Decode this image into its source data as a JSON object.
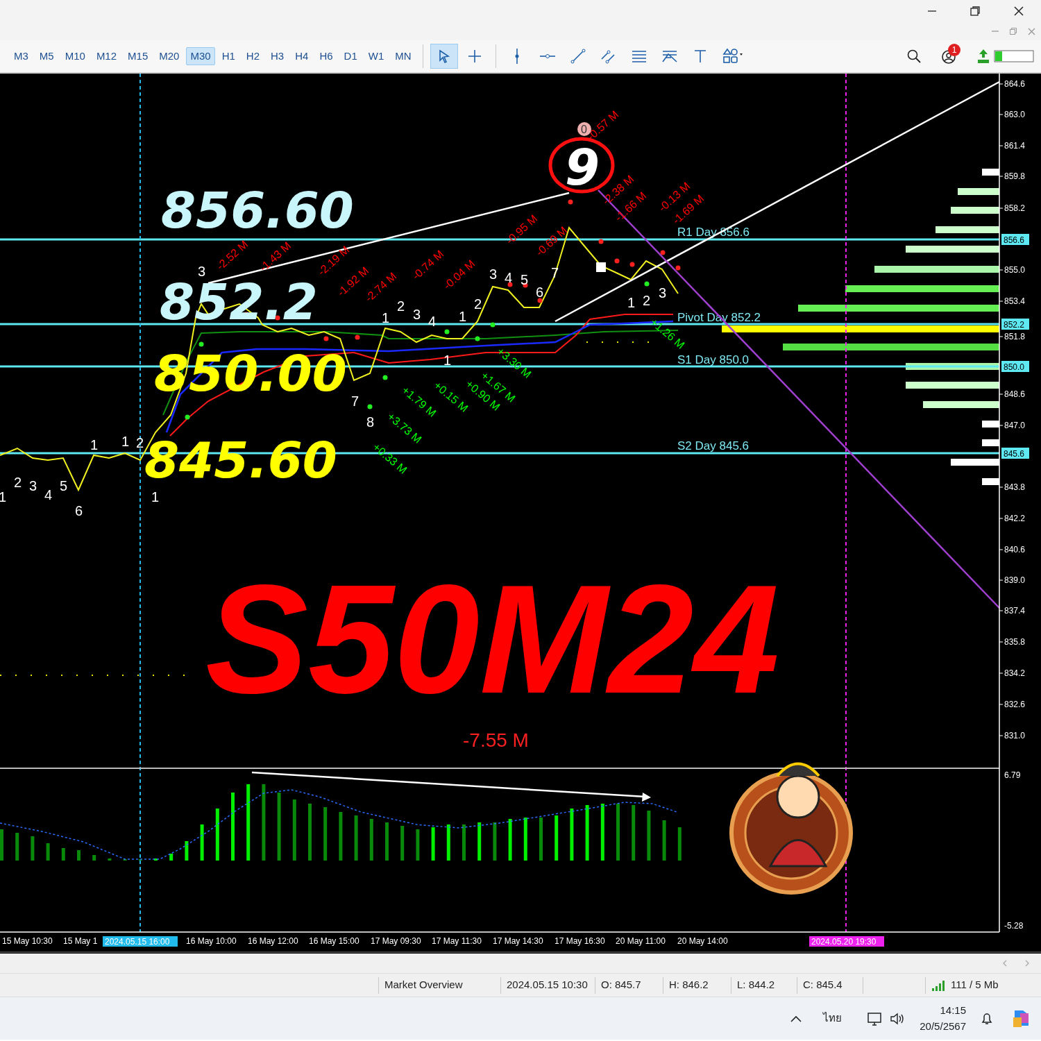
{
  "toolbar": {
    "timeframes": [
      {
        "label": "M3",
        "selected": false
      },
      {
        "label": "M5",
        "selected": false
      },
      {
        "label": "M10",
        "selected": false
      },
      {
        "label": "M12",
        "selected": false
      },
      {
        "label": "M15",
        "selected": false
      },
      {
        "label": "M20",
        "selected": false
      },
      {
        "label": "M30",
        "selected": true
      },
      {
        "label": "H1",
        "selected": false
      },
      {
        "label": "H2",
        "selected": false
      },
      {
        "label": "H3",
        "selected": false
      },
      {
        "label": "H4",
        "selected": false
      },
      {
        "label": "H6",
        "selected": false
      },
      {
        "label": "D1",
        "selected": false
      },
      {
        "label": "W1",
        "selected": false
      },
      {
        "label": "MN",
        "selected": false
      }
    ],
    "tools": [
      {
        "kind": "cursor",
        "selected": true
      },
      {
        "kind": "crosshair",
        "selected": false
      },
      {
        "kind": "vline",
        "selected": false
      },
      {
        "kind": "hline",
        "selected": false
      },
      {
        "kind": "trend",
        "selected": false
      },
      {
        "kind": "channel",
        "selected": false
      },
      {
        "kind": "fibo",
        "selected": false
      },
      {
        "kind": "fan",
        "selected": false
      },
      {
        "kind": "text",
        "selected": false
      },
      {
        "kind": "shapes",
        "selected": false
      }
    ],
    "notification_count": "1"
  },
  "chart": {
    "price_axis": [
      "864.6",
      "863.0",
      "861.4",
      "859.8",
      "858.2",
      "855.0",
      "853.4",
      "851.8",
      "848.6",
      "847.0",
      "843.8",
      "842.2",
      "840.6",
      "839.0",
      "837.4",
      "835.8",
      "834.2",
      "832.6",
      "831.0"
    ],
    "levels": [
      {
        "label": "R1 Day 856.6",
        "tag": "856.6"
      },
      {
        "label": "Pivot Day 852.2",
        "tag": "852.2"
      },
      {
        "label": "S1 Day 850.0",
        "tag": "850.0"
      },
      {
        "label": "S2 Day 845.6",
        "tag": "845.6"
      }
    ],
    "overlay_numbers": [
      {
        "text": "856.60",
        "color": "#c8f6fb"
      },
      {
        "text": "852.2",
        "color": "#c8f6fb"
      },
      {
        "text": "850.00",
        "color": "#ffff00"
      },
      {
        "text": "845.60",
        "color": "#ffff00"
      }
    ],
    "wave_marker": "9",
    "top_marker": "0",
    "volume_labels": [
      {
        "text": "-2.52 M",
        "color": "#ff0000"
      },
      {
        "text": "-1.43 M",
        "color": "#ff0000"
      },
      {
        "text": "-2.19 M",
        "color": "#ff0000"
      },
      {
        "text": "-1.92 M",
        "color": "#ff0000"
      },
      {
        "text": "-2.74 M",
        "color": "#ff0000"
      },
      {
        "text": "-0.74 M",
        "color": "#ff0000"
      },
      {
        "text": "-0.04 M",
        "color": "#ff0000"
      },
      {
        "text": "-0.95 M",
        "color": "#ff0000"
      },
      {
        "text": "-0.69 M",
        "color": "#ff0000"
      },
      {
        "text": "-0.57 M",
        "color": "#ff0000"
      },
      {
        "text": "-2.38 M",
        "color": "#ff0000"
      },
      {
        "text": "-1.66 M",
        "color": "#ff0000"
      },
      {
        "text": "-0.13 M",
        "color": "#ff0000"
      },
      {
        "text": "-1.69 M",
        "color": "#ff0000"
      },
      {
        "text": "+0.33 M",
        "color": "#00ff00"
      },
      {
        "text": "+3.73 M",
        "color": "#00ff00"
      },
      {
        "text": "+1.79 M",
        "color": "#00ff00"
      },
      {
        "text": "+0.15 M",
        "color": "#00ff00"
      },
      {
        "text": "+0.90 M",
        "color": "#00ff00"
      },
      {
        "text": "+1.67 M",
        "color": "#00ff00"
      },
      {
        "text": "+3.30 M",
        "color": "#00ff00"
      },
      {
        "text": "+1.26 M",
        "color": "#00ff00"
      }
    ],
    "wave_counts": [
      "1",
      "2",
      "3",
      "4",
      "5",
      "6",
      "1",
      "1",
      "2",
      "1",
      "3",
      "7",
      "8",
      "1",
      "2",
      "3",
      "4",
      "1",
      "1",
      "2",
      "3",
      "4",
      "5",
      "6",
      "7",
      "1",
      "2",
      "3"
    ],
    "symbol": "S50M24",
    "total_label": "-7.55 M",
    "indicator_axis": [
      "6.79",
      "-5.28"
    ],
    "time_axis": [
      {
        "text": "15 May 10:30",
        "kind": "plain"
      },
      {
        "text": "15 May 1",
        "kind": "plain"
      },
      {
        "text": "2024.05.15 16:00",
        "kind": "cursor"
      },
      {
        "text": "16 May 10:00",
        "kind": "plain"
      },
      {
        "text": "16 May 12:00",
        "kind": "plain"
      },
      {
        "text": "16 May 15:00",
        "kind": "plain"
      },
      {
        "text": "17 May 09:30",
        "kind": "plain"
      },
      {
        "text": "17 May 11:30",
        "kind": "plain"
      },
      {
        "text": "17 May 14:30",
        "kind": "plain"
      },
      {
        "text": "17 May 16:30",
        "kind": "plain"
      },
      {
        "text": "20 May 11:00",
        "kind": "plain"
      },
      {
        "text": "20 May 14:00",
        "kind": "plain"
      },
      {
        "text": "2024.05.20 19:30",
        "kind": "marker"
      }
    ]
  },
  "status_bar": {
    "items": [
      "Market Overview",
      "2024.05.15 10:30",
      "O: 845.7",
      "H: 846.2",
      "L: 844.2",
      "C: 845.4"
    ],
    "memory": "111 / 5 Mb"
  },
  "taskbar": {
    "language": "ไทย",
    "time": "14:15",
    "date": "20/5/2567"
  }
}
